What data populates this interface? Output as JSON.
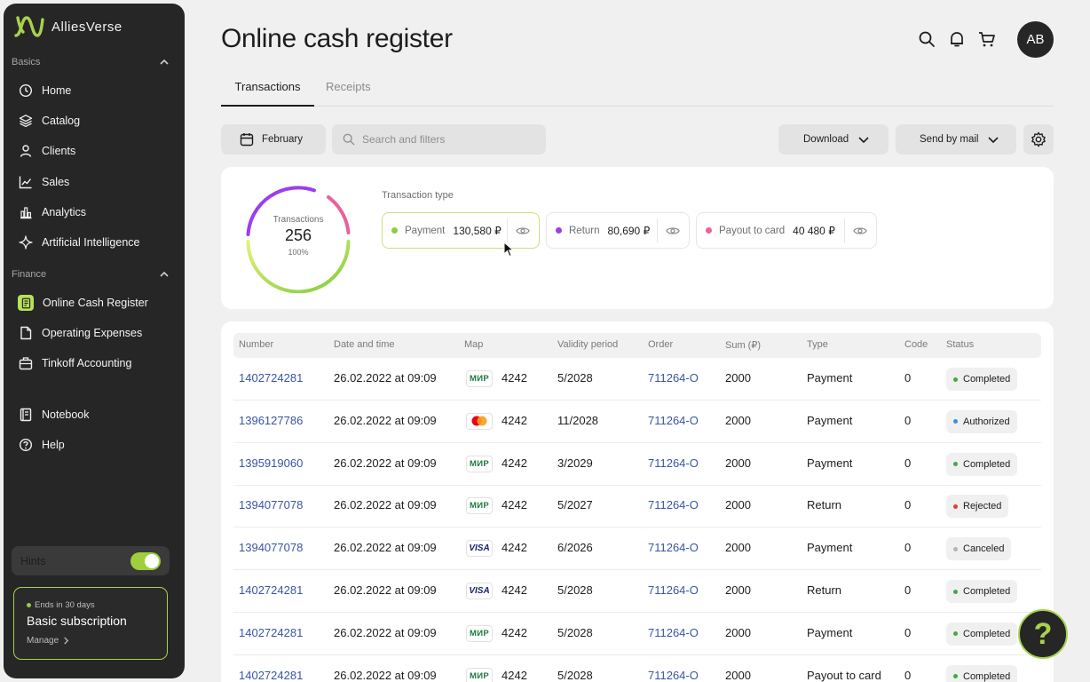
{
  "app": {
    "name": "AlliesVerse"
  },
  "sidebar": {
    "basics_label": "Basics",
    "finance_label": "Finance",
    "basics": [
      {
        "label": "Home",
        "icon": "clock-icon"
      },
      {
        "label": "Catalog",
        "icon": "layers-icon"
      },
      {
        "label": "Clients",
        "icon": "user-icon"
      },
      {
        "label": "Sales",
        "icon": "chart-line-icon"
      },
      {
        "label": "Analytics",
        "icon": "bar-chart-icon"
      },
      {
        "label": "Artificial Intelligence",
        "icon": "sparkle-icon"
      }
    ],
    "finance": [
      {
        "label": "Online Cash Register",
        "icon": "receipt-icon"
      },
      {
        "label": "Operating Expenses",
        "icon": "document-icon"
      },
      {
        "label": "Tinkoff Accounting",
        "icon": "briefcase-icon"
      }
    ],
    "extra": [
      {
        "label": "Notebook",
        "icon": "notebook-icon"
      },
      {
        "label": "Help",
        "icon": "help-circle-icon"
      }
    ],
    "hints_label": "Hints",
    "hints_on": true,
    "subscription": {
      "ends": "Ends in 30 days",
      "title": "Basic subscription",
      "manage": "Manage"
    }
  },
  "header": {
    "title": "Online cash register",
    "avatar_initials": "AB"
  },
  "tabs": [
    {
      "label": "Transactions"
    },
    {
      "label": "Receipts"
    }
  ],
  "toolbar": {
    "period": "February",
    "search_placeholder": "Search and filters",
    "download": "Download",
    "send_by_mail": "Send by mail"
  },
  "summary": {
    "ring_label": "Transactions",
    "ring_value": "256",
    "ring_percent": "100%",
    "type_label": "Transaction type",
    "types": [
      {
        "name": "Payment",
        "value": "130,580 ₽",
        "color": "#8fcf3a"
      },
      {
        "name": "Return",
        "value": "80,690 ₽",
        "color": "#9b3df0"
      },
      {
        "name": "Payout to card",
        "value": "40 480 ₽",
        "color": "#e8629b"
      }
    ]
  },
  "table": {
    "columns": [
      "Number",
      "Date and time",
      "Map",
      "Validity period",
      "Order",
      "Sum (₽)",
      "Type",
      "Code",
      "Status"
    ],
    "rows": [
      {
        "number": "1402724281",
        "date": "26.02.2022 at 09:09",
        "card": "mir",
        "card_digits": "4242",
        "validity": "5/2028",
        "order": "711264-O",
        "sum": "2000",
        "type": "Payment",
        "code": "0",
        "status": "Completed"
      },
      {
        "number": "1396127786",
        "date": "26.02.2022 at 09:09",
        "card": "mastercard",
        "card_digits": "4242",
        "validity": "11/2028",
        "order": "711264-O",
        "sum": "2000",
        "type": "Payment",
        "code": "0",
        "status": "Authorized"
      },
      {
        "number": "1395919060",
        "date": "26.02.2022 at 09:09",
        "card": "mir",
        "card_digits": "4242",
        "validity": "3/2029",
        "order": "711264-O",
        "sum": "2000",
        "type": "Payment",
        "code": "0",
        "status": "Completed"
      },
      {
        "number": "1394077078",
        "date": "26.02.2022 at 09:09",
        "card": "mir",
        "card_digits": "4242",
        "validity": "5/2027",
        "order": "711264-O",
        "sum": "2000",
        "type": "Return",
        "code": "0",
        "status": "Rejected"
      },
      {
        "number": "1394077078",
        "date": "26.02.2022 at 09:09",
        "card": "visa",
        "card_digits": "4242",
        "validity": "6/2026",
        "order": "711264-O",
        "sum": "2000",
        "type": "Payment",
        "code": "0",
        "status": "Canceled"
      },
      {
        "number": "1402724281",
        "date": "26.02.2022 at 09:09",
        "card": "visa",
        "card_digits": "4242",
        "validity": "5/2028",
        "order": "711264-O",
        "sum": "2000",
        "type": "Return",
        "code": "0",
        "status": "Completed"
      },
      {
        "number": "1402724281",
        "date": "26.02.2022 at 09:09",
        "card": "mir",
        "card_digits": "4242",
        "validity": "5/2028",
        "order": "711264-O",
        "sum": "2000",
        "type": "Payment",
        "code": "0",
        "status": "Completed"
      },
      {
        "number": "1402724281",
        "date": "26.02.2022 at 09:09",
        "card": "mir",
        "card_digits": "4242",
        "validity": "5/2028",
        "order": "711264-O",
        "sum": "2000",
        "type": "Payout to card",
        "code": "0",
        "status": "Completed"
      }
    ],
    "status_colors": {
      "Completed": "#3fae3f",
      "Authorized": "#3d8fe0",
      "Rejected": "#d9413b",
      "Canceled": "#b5b5b5"
    },
    "card_labels": {
      "mir": "МИР",
      "visa": "VISA"
    }
  },
  "help_glyph": "?"
}
